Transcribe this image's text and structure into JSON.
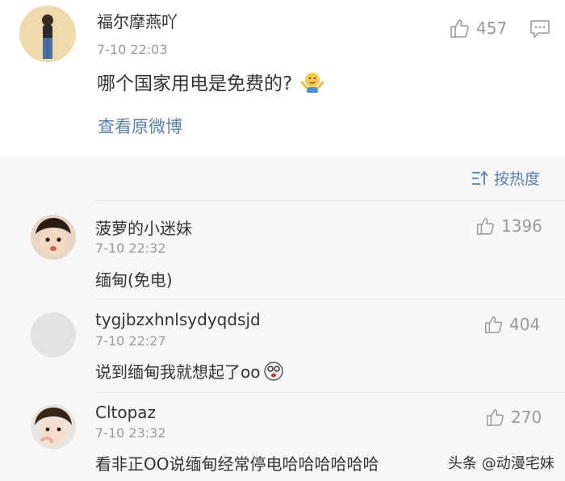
{
  "post": {
    "author": "福尔摩燕吖",
    "time": "7-10 22:03",
    "likes": "457",
    "text": "哪个国家用电是免费的?",
    "view_link": "查看原微博"
  },
  "sort_label": "按热度",
  "comments": [
    {
      "author": "菠萝的小迷妹",
      "time": "7-10 22:32",
      "likes": "1396",
      "text": "缅甸(免电)"
    },
    {
      "author": "tygjbzxhnlsydyqdsjd",
      "time": "7-10 22:27",
      "likes": "404",
      "text": "说到缅甸我就想起了oo"
    },
    {
      "author": "Cltopaz",
      "time": "7-10 23:32",
      "likes": "270",
      "text": "看非正OO说缅甸经常停电哈哈哈哈哈哈"
    }
  ],
  "watermark": "头条 @动漫宅妹",
  "colors": {
    "link": "#5b7fb0",
    "muted": "#999999",
    "text": "#333333",
    "background_comments": "#f7f7f7"
  }
}
